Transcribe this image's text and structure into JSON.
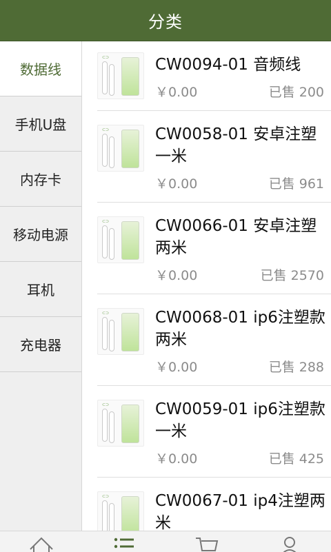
{
  "header": {
    "title": "分类"
  },
  "sidebar": {
    "items": [
      {
        "label": "数据线"
      },
      {
        "label": "手机U盘"
      },
      {
        "label": "内存卡"
      },
      {
        "label": "移动电源"
      },
      {
        "label": "耳机"
      },
      {
        "label": "充电器"
      }
    ],
    "active_index": 0
  },
  "products": [
    {
      "name": "CW0094-01 音频线",
      "price": "￥0.00",
      "sold": "已售 200"
    },
    {
      "name": "CW0058-01 安卓注塑一米",
      "price": "￥0.00",
      "sold": "已售 961"
    },
    {
      "name": "CW0066-01 安卓注塑两米",
      "price": "￥0.00",
      "sold": "已售 2570"
    },
    {
      "name": "CW0068-01 ip6注塑款 两米",
      "price": "￥0.00",
      "sold": "已售 288"
    },
    {
      "name": "CW0059-01 ip6注塑款 一米",
      "price": "￥0.00",
      "sold": "已售 425"
    },
    {
      "name": "CW0067-01 ip4注塑两米",
      "price": "",
      "sold": ""
    }
  ],
  "bottom_nav": {
    "items": [
      {
        "icon": "home-icon"
      },
      {
        "icon": "list-icon"
      },
      {
        "icon": "cart-icon"
      },
      {
        "icon": "user-icon"
      }
    ]
  },
  "colors": {
    "accent": "#4f6b35",
    "sidebar_bg": "#efefef",
    "muted_text": "#8b8b8b"
  }
}
